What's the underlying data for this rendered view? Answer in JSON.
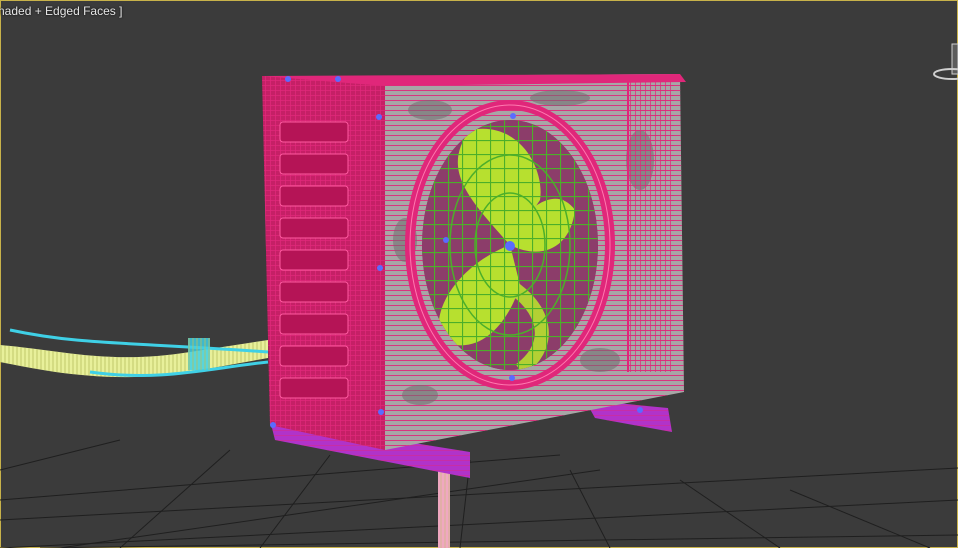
{
  "viewport": {
    "label": "naded + Edged Faces ]",
    "display_mode": "Shaded + Edged Faces"
  },
  "scene": {
    "object": "outdoor-ac-unit",
    "colors": {
      "background": "#3b3b3b",
      "grid": "#1e1e1e",
      "casing_wire": "#e0277a",
      "casing_face": "#a7a6a6",
      "fan_blade": "#b7e02f",
      "fan_guard": "#4caf2a",
      "hose": "#e8f09a",
      "hose_clamp": "#3fd0e6",
      "bracket": "#c23bd6",
      "vertices": "#5a6bff",
      "drain_pipe": "#f0a8c0"
    }
  },
  "icons": {
    "viewcube": "viewcube-icon"
  }
}
